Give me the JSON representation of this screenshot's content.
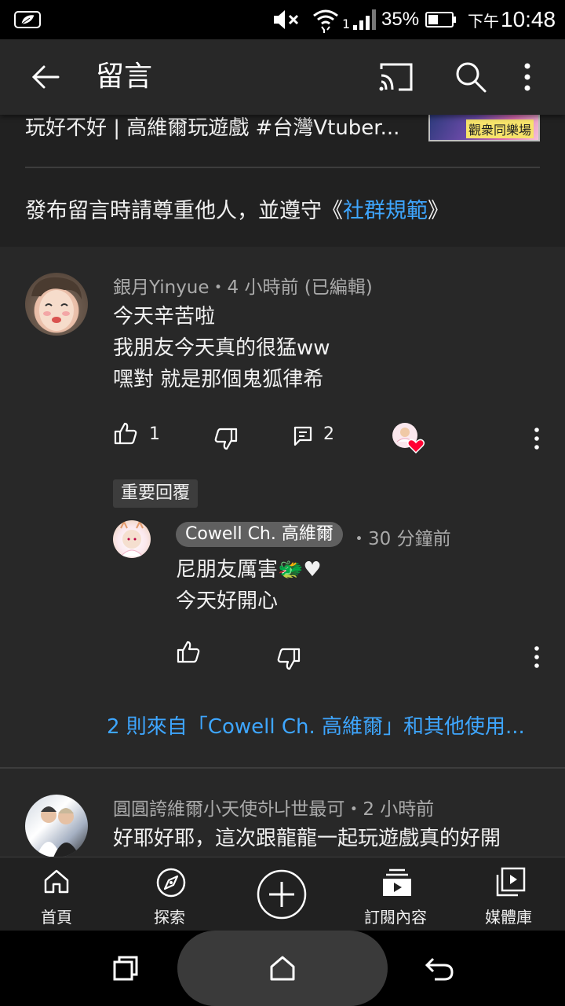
{
  "status_bar": {
    "left_icon": "leaf-notification-icon",
    "battery_percent": "35%",
    "time_period": "下午",
    "time": "10:48",
    "signal_label": "1"
  },
  "app_bar": {
    "title": "留言",
    "icons": [
      "back-arrow-icon",
      "cast-icon",
      "search-icon",
      "more-vert-icon"
    ]
  },
  "video": {
    "title": "玩好不好 | 高維爾玩遊戲 #台灣Vtuber...",
    "thumb_text": "觀衆同樂場"
  },
  "notice": {
    "prefix": "發布留言時請尊重他人，並遵守《",
    "link": "社群規範",
    "suffix": "》"
  },
  "comment1": {
    "author": "銀月Yinyue",
    "meta": "銀月Yinyue・4 小時前 (已編輯)",
    "lines": [
      "今天辛苦啦",
      "我朋友今天真的很猛ww",
      "嘿對 就是那個鬼狐律希"
    ],
    "likes": "1",
    "replies": "2",
    "hearted_by_creator": true
  },
  "pinned_reply_label": "重要回覆",
  "reply1": {
    "author": "Cowell Ch. 高維爾",
    "time": "・30 分鐘前",
    "lines": [
      "尼朋友厲害🐲♥",
      "今天好開心"
    ]
  },
  "more_replies": "2 則來自「Cowell Ch. 高維爾」和其他使用...",
  "comment2": {
    "meta": "圓圓誇維爾小天使하나世最可・2 小時前",
    "lines": [
      "好耶好耶，這次跟龍龍一起玩遊戲真的好開"
    ]
  },
  "bottom_nav": [
    {
      "label": "首頁",
      "icon": "home-icon"
    },
    {
      "label": "探索",
      "icon": "explore-icon"
    },
    {
      "label": "",
      "icon": "add-icon"
    },
    {
      "label": "訂閱內容",
      "icon": "subscriptions-icon"
    },
    {
      "label": "媒體庫",
      "icon": "library-icon"
    }
  ],
  "colors": {
    "background": "#282828",
    "link": "#3ea6ff",
    "secondary_text": "#aaaaaa",
    "heart": "#ff0033"
  }
}
